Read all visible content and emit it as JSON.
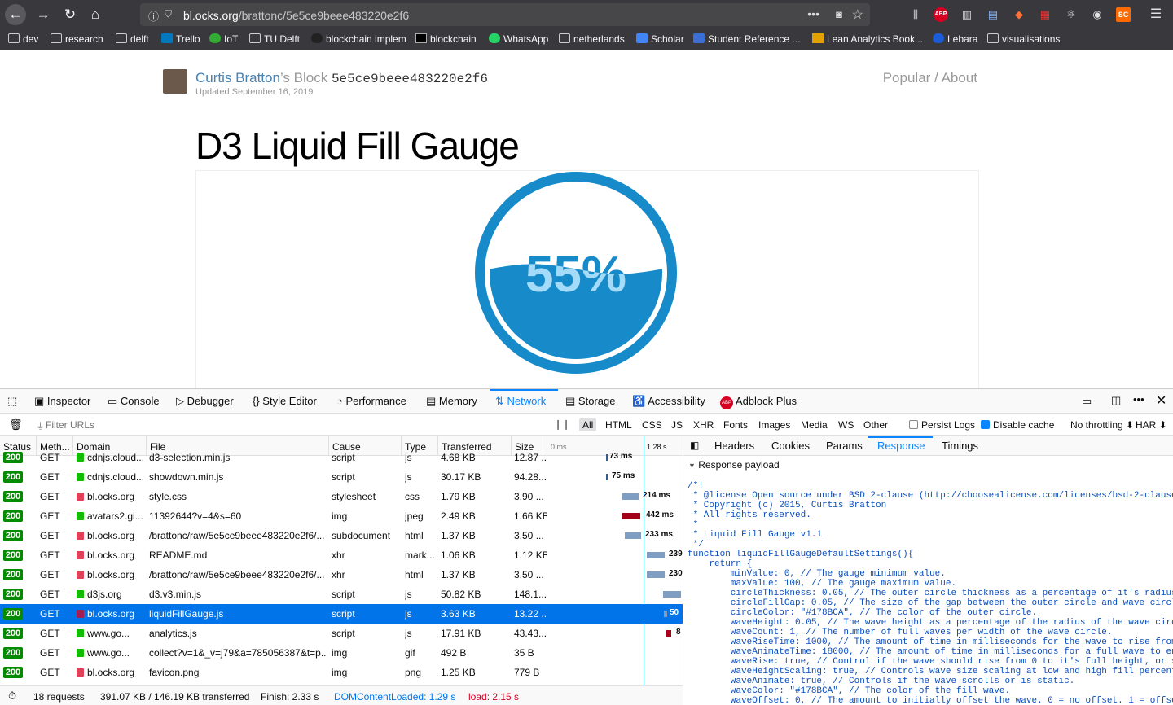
{
  "browser": {
    "url_host": "bl.ocks.org",
    "url_path": "/brattonc/5e5ce9beee483220e2f6",
    "url_more": "•••",
    "bookmarks": [
      "dev",
      "research",
      "delft",
      "Trello",
      "IoT",
      "TU Delft",
      "blockchain implem",
      "blockchain",
      "WhatsApp",
      "netherlands",
      "Scholar",
      "Student Reference ...",
      "Lean Analytics Book...",
      "Lebara",
      "visualisations"
    ]
  },
  "page": {
    "author_name": "Curtis Bratton",
    "author_suffix": "’s Block",
    "block_id": "5e5ce9beee483220e2f6",
    "updated": "Updated September 16, 2019",
    "popular": "Popular",
    "about": "About",
    "links_sep": " / ",
    "title": "D3 Liquid Fill Gauge",
    "gauge_label": "55%",
    "gauge_value": 55,
    "gauge_color": "#178BCA",
    "gauge_text_color": "#A4DBf8"
  },
  "devtools": {
    "tabs": [
      "Inspector",
      "Console",
      "Debugger",
      "Style Editor",
      "Performance",
      "Memory",
      "Network",
      "Storage",
      "Accessibility",
      "Adblock Plus"
    ],
    "selected_tab": "Network",
    "filter_placeholder": "Filter URLs",
    "types": [
      "All",
      "HTML",
      "CSS",
      "JS",
      "XHR",
      "Fonts",
      "Images",
      "Media",
      "WS",
      "Other"
    ],
    "persist_logs": "Persist Logs",
    "disable_cache": "Disable cache",
    "throttling": "No throttling ⬍",
    "har": "HAR ⬍",
    "columns": [
      "Status",
      "Meth...",
      "Domain",
      "File",
      "Cause",
      "Type",
      "Transferred",
      "Size",
      "0 ms",
      "1.28 s"
    ],
    "requests": [
      {
        "status": "200",
        "method": "GET",
        "secure": true,
        "domain": "cdnjs.cloud...",
        "file": "d3-selection.min.js",
        "cause": "script",
        "type": "js",
        "transferred": "4.68 KB",
        "size": "12.87 ...",
        "timing": "73 ms"
      },
      {
        "status": "200",
        "method": "GET",
        "secure": true,
        "domain": "cdnjs.cloud...",
        "file": "showdown.min.js",
        "cause": "script",
        "type": "js",
        "transferred": "30.17 KB",
        "size": "94.28...",
        "timing": "75 ms"
      },
      {
        "status": "200",
        "method": "GET",
        "secure": false,
        "domain": "bl.ocks.org",
        "file": "style.css",
        "cause": "stylesheet",
        "type": "css",
        "transferred": "1.79 KB",
        "size": "3.90 ...",
        "timing": "214 ms"
      },
      {
        "status": "200",
        "method": "GET",
        "secure": true,
        "domain": "avatars2.gi...",
        "file": "11392644?v=4&s=60",
        "cause": "img",
        "type": "jpeg",
        "transferred": "2.49 KB",
        "size": "1.66 KB",
        "timing": "442 ms"
      },
      {
        "status": "200",
        "method": "GET",
        "secure": false,
        "domain": "bl.ocks.org",
        "file": "/brattonc/raw/5e5ce9beee483220e2f6/...",
        "cause": "subdocument",
        "type": "html",
        "transferred": "1.37 KB",
        "size": "3.50 ...",
        "timing": "233 ms"
      },
      {
        "status": "200",
        "method": "GET",
        "secure": false,
        "domain": "bl.ocks.org",
        "file": "README.md",
        "cause": "xhr",
        "type": "mark...",
        "transferred": "1.06 KB",
        "size": "1.12 KB",
        "timing": "239"
      },
      {
        "status": "200",
        "method": "GET",
        "secure": false,
        "domain": "bl.ocks.org",
        "file": "/brattonc/raw/5e5ce9beee483220e2f6/...",
        "cause": "xhr",
        "type": "html",
        "transferred": "1.37 KB",
        "size": "3.50 ...",
        "timing": "230"
      },
      {
        "status": "200",
        "method": "GET",
        "secure": true,
        "domain": "d3js.org",
        "file": "d3.v3.min.js",
        "cause": "script",
        "type": "js",
        "transferred": "50.82 KB",
        "size": "148.1...",
        "timing": ""
      },
      {
        "status": "200",
        "method": "GET",
        "secure": false,
        "domain": "bl.ocks.org",
        "file": "liquidFillGauge.js",
        "cause": "script",
        "type": "js",
        "transferred": "3.63 KB",
        "size": "13.22 ...",
        "timing": "50"
      },
      {
        "status": "200",
        "method": "GET",
        "secure": true,
        "domain": "www.go...",
        "file": "analytics.js",
        "cause": "script",
        "type": "js",
        "transferred": "17.91 KB",
        "size": "43.43...",
        "timing": "8"
      },
      {
        "status": "200",
        "method": "GET",
        "secure": true,
        "domain": "www.go...",
        "file": "collect?v=1&_v=j79&a=785056387&t=p...",
        "cause": "img",
        "type": "gif",
        "transferred": "492 B",
        "size": "35 B",
        "timing": ""
      },
      {
        "status": "200",
        "method": "GET",
        "secure": false,
        "domain": "bl.ocks.org",
        "file": "favicon.png",
        "cause": "img",
        "type": "png",
        "transferred": "1.25 KB",
        "size": "779 B",
        "timing": ""
      }
    ],
    "summary": {
      "requests": "18 requests",
      "transferred": "391.07 KB / 146.19 KB transferred",
      "finish": "Finish: 2.33 s",
      "domcontent": "DOMContentLoaded: 1.29 s",
      "load": "load: 2.15 s"
    },
    "side_tabs": [
      "Headers",
      "Cookies",
      "Params",
      "Response",
      "Timings"
    ],
    "side_selected": "Response",
    "payload_label": "Response payload",
    "code": "/*!\n * @license Open source under BSD 2-clause (http://choosealicense.com/licenses/bsd-2-clause/)\n * Copyright (c) 2015, Curtis Bratton\n * All rights reserved.\n *\n * Liquid Fill Gauge v1.1\n */\nfunction liquidFillGaugeDefaultSettings(){\n    return {\n        minValue: 0, // The gauge minimum value.\n        maxValue: 100, // The gauge maximum value.\n        circleThickness: 0.05, // The outer circle thickness as a percentage of it's radius.\n        circleFillGap: 0.05, // The size of the gap between the outer circle and wave circle\n        circleColor: \"#178BCA\", // The color of the outer circle.\n        waveHeight: 0.05, // The wave height as a percentage of the radius of the wave circle\n        waveCount: 1, // The number of full waves per width of the wave circle.\n        waveRiseTime: 1000, // The amount of time in milliseconds for the wave to rise from\n        waveAnimateTime: 18000, // The amount of time in milliseconds for a full wave to enter\n        waveRise: true, // Control if the wave should rise from 0 to it's full height, or s\n        waveHeightScaling: true, // Controls wave size scaling at low and high fill percent\n        waveAnimate: true, // Controls if the wave scrolls or is static.\n        waveColor: \"#178BCA\", // The color of the fill wave.\n        waveOffset: 0, // The amount to initially offset the wave. 0 = no offset. 1 = offse"
  }
}
